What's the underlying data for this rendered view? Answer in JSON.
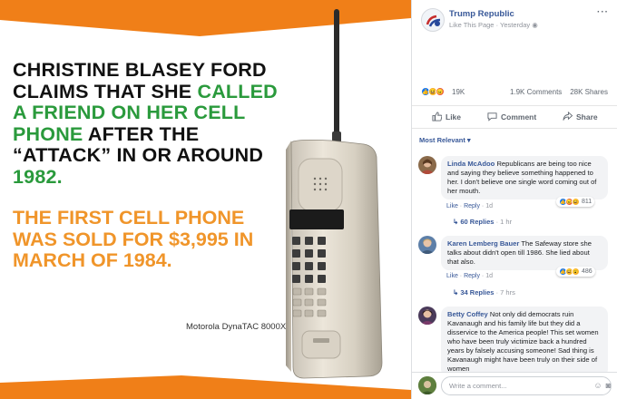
{
  "image": {
    "headline_parts": [
      {
        "text": "CHRISTINE BLASEY FORD CLAIMS THAT SHE ",
        "color": "#111111"
      },
      {
        "text": "CALLED A FRIEND ON HER CELL PHONE",
        "color": "#2a9a3c"
      },
      {
        "text": " AFTER THE “ATTACK” IN OR AROUND ",
        "color": "#111111"
      },
      {
        "text": "1982.",
        "color": "#2a9a3c"
      }
    ],
    "subhead": "THE FIRST CELL PHONE WAS SOLD FOR $3,995 IN MARCH OF 1984.",
    "caption": "Motorola DynaTAC 8000X",
    "accent_orange": "#f07f18"
  },
  "post": {
    "page_name": "Trump Republic",
    "like_page": "Like This Page",
    "time": "Yesterday",
    "more": "···",
    "reactions_count": "19K",
    "comments_count": "1.9K Comments",
    "shares_count": "28K Shares",
    "actions": {
      "like": "Like",
      "comment": "Comment",
      "share": "Share"
    },
    "sort_label": "Most Relevant ▾"
  },
  "comments": [
    {
      "name": "Linda McAdoo",
      "text": "Republicans are being too nice and saying they believe something happened to her. I don't believe one single word coming out of her mouth.",
      "reactions": "811",
      "like": "Like",
      "reply": "Reply",
      "age": "1d",
      "replies": "60 Replies",
      "replies_age": "1 hr"
    },
    {
      "name": "Karen Lemberg Bauer",
      "text": "The Safeway store she talks about didn't open till 1986. She lied about that also.",
      "reactions": "486",
      "like": "Like",
      "reply": "Reply",
      "age": "1d",
      "replies": "34 Replies",
      "replies_age": "7 hrs"
    },
    {
      "name": "Betty Coffey",
      "text": "Not only did democrats ruin Kavanaugh and his family life but they did a disservice to the America people! This set women who have been truly victimize back a hundred years by falsely accusing someone! Sad thing is Kavanaugh might have been truly on their side of women"
    }
  ],
  "composer": {
    "placeholder": "Write a comment..."
  }
}
